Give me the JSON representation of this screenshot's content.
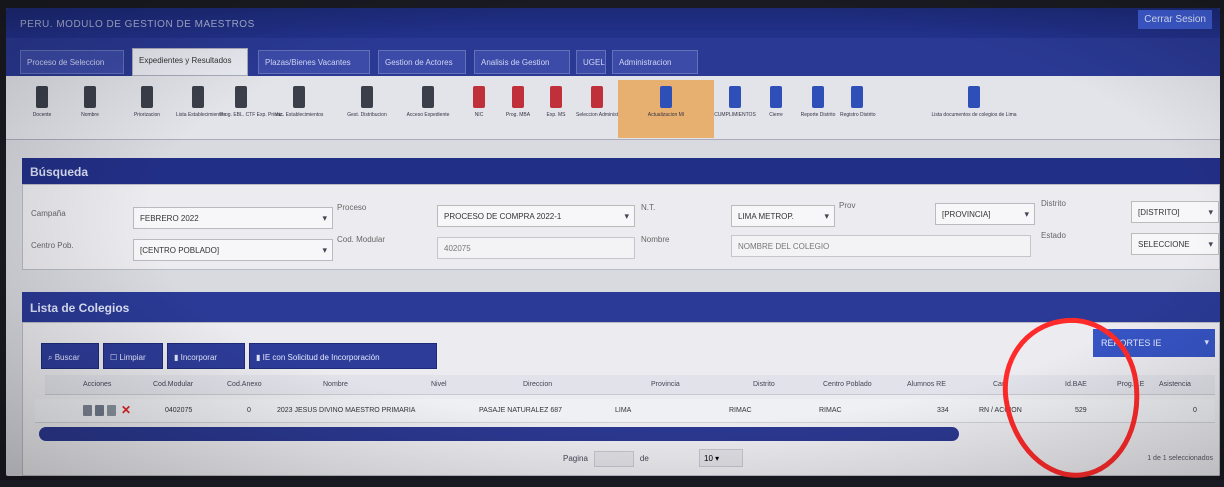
{
  "window": {
    "title": "PERU. MODULO DE GESTION DE MAESTROS",
    "user_label": "Cerrar Sesion"
  },
  "tabs": [
    {
      "label": "Proceso de Seleccion"
    },
    {
      "label": "Expedientes y Resultados"
    },
    {
      "label": "Plazas/Bienes Vacantes"
    },
    {
      "label": "Gestion de Actores"
    },
    {
      "label": "Analisis de Gestion"
    },
    {
      "label": "UGEL"
    },
    {
      "label": "Administracion"
    }
  ],
  "toolbar": {
    "items": [
      {
        "label": "Docente",
        "icon": "lock-icon",
        "color": "#3a3f4a"
      },
      {
        "label": "Nombre",
        "icon": "lock-icon",
        "color": "#3a3f4a"
      },
      {
        "label": "Priorizacion",
        "icon": "lock-icon",
        "color": "#3a3f4a"
      },
      {
        "label": "Lista Establecimientos",
        "icon": "lock-icon",
        "color": "#3a3f4a"
      },
      {
        "label": "Prog. EBL. CTF Exp. Prioriz.",
        "icon": "lock-icon",
        "color": "#3a3f4a"
      },
      {
        "label": "Vac. Establecimientos",
        "icon": "lock-icon",
        "color": "#3a3f4a"
      },
      {
        "label": "Gest. Distribucion",
        "icon": "lock-icon",
        "color": "#3a3f4a"
      },
      {
        "label": "Acceso Expediente",
        "icon": "lock-icon",
        "color": "#3a3f4a"
      },
      {
        "label": "NIC",
        "icon": "lock-red-icon",
        "color": "#c0303a"
      },
      {
        "label": "Prog. MBA",
        "icon": "lock-red-icon",
        "color": "#c0303a"
      },
      {
        "label": "Exp. MS",
        "icon": "lock-red-icon",
        "color": "#c0303a"
      },
      {
        "label": "Seleccion Administrativa",
        "icon": "lock-red-icon",
        "color": "#c0303a"
      },
      {
        "label": "Actualizacion MI",
        "icon": "file-blue-icon",
        "color": "#2e4fb8",
        "active": true
      },
      {
        "label": "CUMPLIMIENTOS",
        "icon": "file-blue-icon",
        "color": "#2e4fb8"
      },
      {
        "label": "Cierre",
        "icon": "file-blue-icon",
        "color": "#2e4fb8"
      },
      {
        "label": "Reporte Distrito",
        "icon": "file-blue-icon",
        "color": "#2e4fb8"
      },
      {
        "label": "Registro Distrito",
        "icon": "file-blue-icon",
        "color": "#2e4fb8"
      },
      {
        "label": "Lista documentos de colegios de Lima",
        "icon": "file-blue-icon",
        "color": "#2e4fb8"
      }
    ]
  },
  "search": {
    "title": "Búsqueda",
    "row1": {
      "campaign_label": "Campaña",
      "campaign_value": "FEBRERO 2022",
      "process_label": "Proceso",
      "process_value": "PROCESO DE COMPRA 2022-1",
      "nt_label": "N.T.",
      "nt_value": "LIMA METROP.",
      "prov_label": "Prov",
      "prov_value": "[PROVINCIA]",
      "district_label": "Distrito",
      "district_value": "[DISTRITO]"
    },
    "row2": {
      "center_label": "Centro Pob.",
      "center_value": "[CENTRO POBLADO]",
      "modcode_label": "Cod. Modular",
      "modcode_value": "402075",
      "name_label": "Nombre",
      "name_placeholder": "NOMBRE DEL COLEGIO",
      "state_label": "Estado",
      "state_value": "SELECCIONE"
    }
  },
  "list": {
    "title": "Lista de Colegios",
    "buttons": {
      "search": "Buscar",
      "clear": "Limpiar",
      "incorporate": "Incorporar",
      "request": "IE con Solicitud de Incorporación"
    },
    "reports_label": "REPORTES IE",
    "columns": [
      "Acciones",
      "Cod.Modular",
      "Cod.Anexo",
      "Nombre",
      "Nivel",
      "Direccion",
      "Provincia",
      "Distrito",
      "Centro Poblado",
      "Alumnos RE",
      "Cant",
      "Id.BAE",
      "Prog. LE",
      "Asistencia"
    ],
    "rows": [
      {
        "cod_modular": "0402075",
        "cod_anexo": "0",
        "nombre": "2023 JESUS DIVINO MAESTRO PRIMARIA",
        "nivel": "",
        "direccion": "PASAJE NATURALEZ 687",
        "provincia": "LIMA",
        "distrito": "RIMAC",
        "centro_poblado": "RIMAC",
        "alumnos": "334",
        "cant": "RN / ACCION",
        "id_bae": "529",
        "extra": "0"
      }
    ],
    "pager": {
      "page_label": "Pagina",
      "of_label": "de",
      "per_page": "10"
    },
    "footer_note": "1 de 1 seleccionados"
  }
}
